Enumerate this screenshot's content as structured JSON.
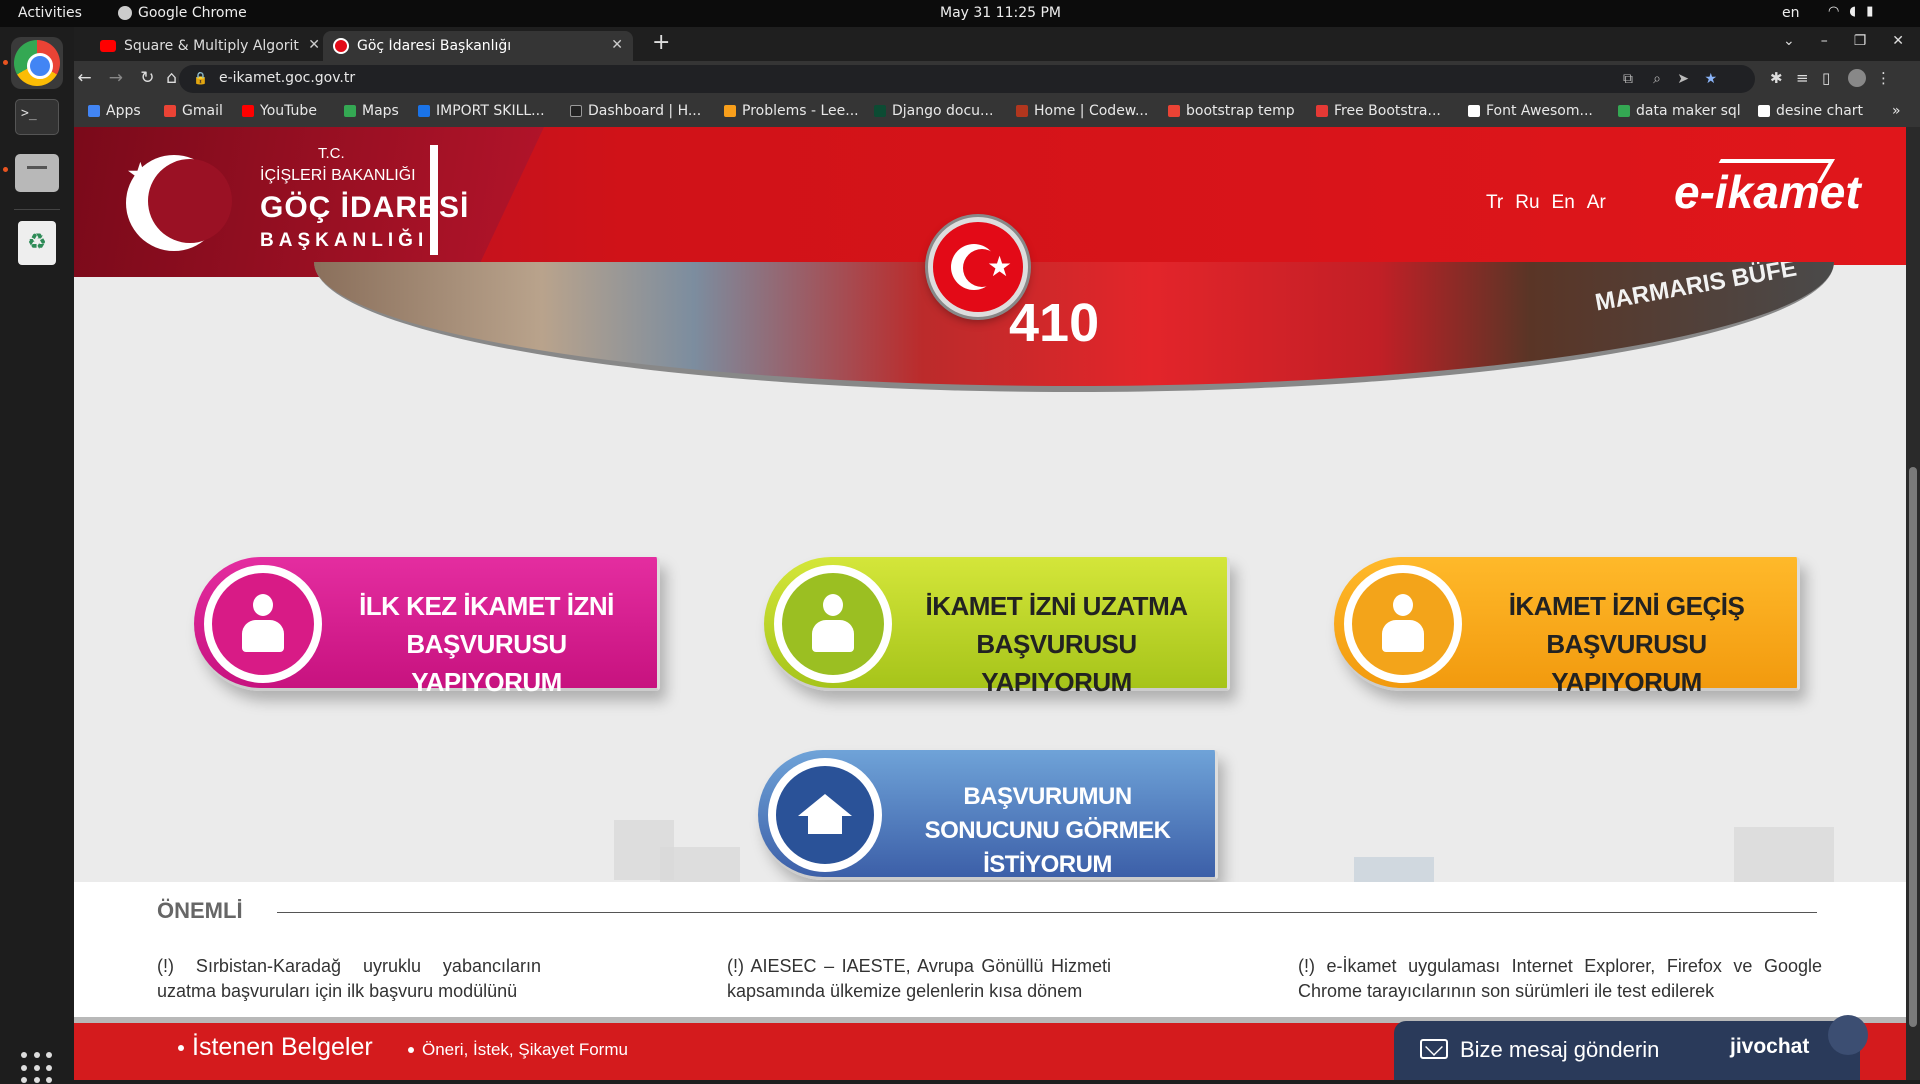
{
  "os": {
    "activities": "Activities",
    "app_name": "Google Chrome",
    "clock": "May 31  11:25 PM",
    "language": "en"
  },
  "browser": {
    "tabs": [
      {
        "label": "Square & Multiply Algorit",
        "icon": "youtube-icon"
      },
      {
        "label": "Göç İdaresi Başkanlığı",
        "icon": "goc-favicon"
      }
    ],
    "url": "e-ikamet.goc.gov.tr",
    "bookmarks": [
      {
        "label": "Apps",
        "color": "#4285f4"
      },
      {
        "label": "Gmail",
        "color": "#ea4335"
      },
      {
        "label": "YouTube",
        "color": "#ff0000"
      },
      {
        "label": "Maps",
        "color": "#34a853"
      },
      {
        "label": "IMPORT SKILL...",
        "color": "#1a73e8"
      },
      {
        "label": "Dashboard | H...",
        "color": "#333333"
      },
      {
        "label": "Problems - Lee...",
        "color": "#f89f1b"
      },
      {
        "label": "Django docu...",
        "color": "#0c4b33"
      },
      {
        "label": "Home | Codew...",
        "color": "#b1361e"
      },
      {
        "label": "bootstrap temp",
        "color": "#ea4335"
      },
      {
        "label": "Free Bootstra...",
        "color": "#e53935"
      },
      {
        "label": "Font Awesom...",
        "color": "#ffffff"
      },
      {
        "label": "data maker sql",
        "color": "#34a853"
      },
      {
        "label": "desine chart",
        "color": "#ffffff"
      }
    ]
  },
  "site": {
    "logo": {
      "tc": "T.C.",
      "line1": "İÇİŞLERİ BAKANLIĞI",
      "line2": "GÖÇ İDARESİ",
      "line3": "BAŞKANLIĞI"
    },
    "languages": [
      "Tr",
      "Ru",
      "En",
      "Ar"
    ],
    "brand": "e-ikamet",
    "banner": {
      "tram_number": "410",
      "sign": "MARMARIS BÜFE"
    },
    "buttons": {
      "first_application": "İLK KEZ İKAMET İZNİ BAŞVURUSU YAPIYORUM",
      "extension": "İKAMET İZNİ UZATMA BAŞVURUSU YAPIYORUM",
      "transfer": "İKAMET İZNİ GEÇİŞ BAŞVURUSU YAPIYORUM",
      "result": "BAŞVURUMUN SONUCUNU GÖRMEK İSTİYORUM"
    },
    "important": {
      "title": "ÖNEMLİ",
      "col1": "(!) Sırbistan-Karadağ uyruklu yabancıların uzatma başvuruları için ilk başvuru modülünü",
      "col2": "(!) AIESEC – IAESTE, Avrupa Gönüllü Hizmeti kapsamında ülkemize gelenlerin kısa dönem",
      "col3": "(!) e-İkamet uygulaması Internet Explorer, Firefox ve Google Chrome tarayıcılarının son sürümleri ile test edilerek"
    },
    "footer": {
      "link1": "İstenen Belgeler",
      "link2": "Öneri, İstek, Şikayet Formu"
    },
    "chat": {
      "label": "Bize mesaj gönderin",
      "brand": "jivochat"
    }
  }
}
